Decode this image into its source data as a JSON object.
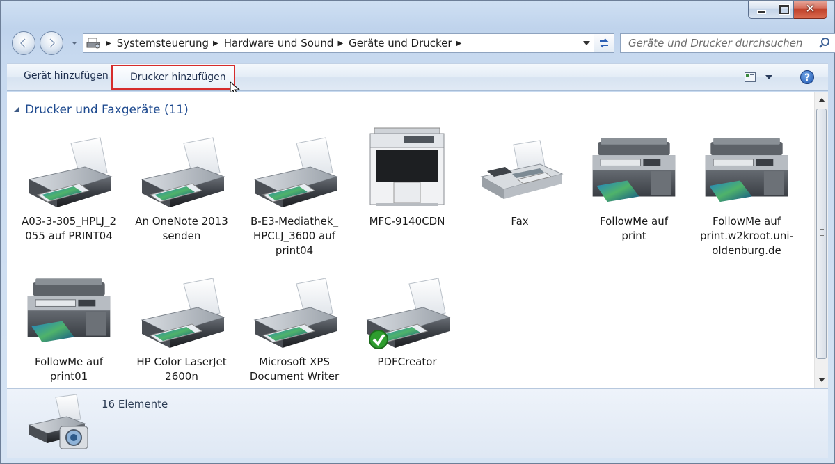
{
  "window": {
    "caption": {
      "minimize": "minimize",
      "maximize": "maximize",
      "close": "✕"
    }
  },
  "nav": {
    "breadcrumbs": [
      "Systemsteuerung",
      "Hardware und Sound",
      "Geräte und Drucker"
    ],
    "search_placeholder": "Geräte und Drucker durchsuchen"
  },
  "toolbar": {
    "add_device_label": "Gerät hinzufügen",
    "add_printer_label": "Drucker hinzufügen",
    "help_label": "?"
  },
  "group": {
    "title": "Drucker und Faxgeräte (11)"
  },
  "devices": [
    {
      "label_line1": "A03-3-305_HPLJ_2",
      "label_line2": "055 auf PRINT04",
      "label_line3": "",
      "icon": "printer-icon"
    },
    {
      "label_line1": "An OneNote 2013",
      "label_line2": "senden",
      "label_line3": "",
      "icon": "printer-icon"
    },
    {
      "label_line1": "B-E3-Mediathek_",
      "label_line2": "HPCLJ_3600 auf",
      "label_line3": "print04",
      "icon": "printer-icon"
    },
    {
      "label_line1": "MFC-9140CDN",
      "label_line2": "",
      "label_line3": "",
      "icon": "multifunction-printer-icon"
    },
    {
      "label_line1": "Fax",
      "label_line2": "",
      "label_line3": "",
      "icon": "fax-icon"
    },
    {
      "label_line1": "FollowMe auf",
      "label_line2": "print",
      "label_line3": "",
      "icon": "mfp-icon"
    },
    {
      "label_line1": "FollowMe auf",
      "label_line2": "print.w2kroot.uni-",
      "label_line3": "oldenburg.de",
      "icon": "mfp-icon"
    },
    {
      "label_line1": "FollowMe auf",
      "label_line2": "print01",
      "label_line3": "",
      "icon": "mfp-icon"
    },
    {
      "label_line1": "HP Color LaserJet",
      "label_line2": "2600n",
      "label_line3": "",
      "icon": "printer-icon"
    },
    {
      "label_line1": "Microsoft XPS",
      "label_line2": "Document Writer",
      "label_line3": "",
      "icon": "printer-icon"
    },
    {
      "label_line1": "PDFCreator",
      "label_line2": "",
      "label_line3": "",
      "icon": "printer-default-icon"
    }
  ],
  "details": {
    "count": "16 Elemente"
  },
  "colors": {
    "highlight_border": "#d62c2c",
    "group_title": "#1e4a8f",
    "default_check": "#2e9d2e"
  }
}
